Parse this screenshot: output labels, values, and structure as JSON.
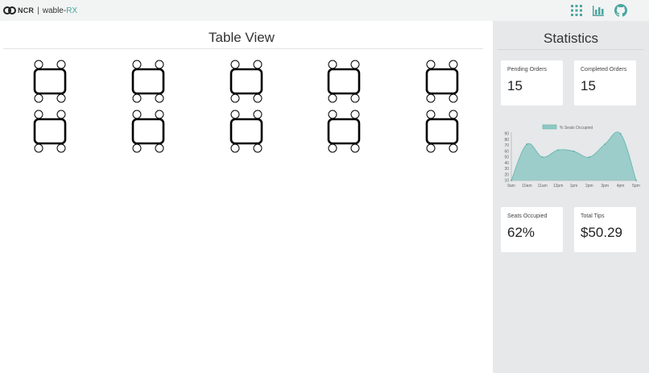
{
  "header": {
    "brand_ncr": "NCR",
    "brand_separator": "|",
    "brand_name": "wable-",
    "brand_suffix": "RX",
    "icons": [
      "grid-icon",
      "bar-chart-icon",
      "github-icon"
    ]
  },
  "main": {
    "title": "Table View",
    "tables": [
      {
        "id": "table-1"
      },
      {
        "id": "table-2"
      },
      {
        "id": "table-3"
      },
      {
        "id": "table-4"
      },
      {
        "id": "table-5"
      },
      {
        "id": "table-6"
      },
      {
        "id": "table-7"
      },
      {
        "id": "table-8"
      },
      {
        "id": "table-9"
      },
      {
        "id": "table-10"
      }
    ]
  },
  "stats": {
    "title": "Statistics",
    "pending_label": "Pending Orders",
    "pending_value": "15",
    "completed_label": "Completed Orders",
    "completed_value": "15",
    "seats_label": "Seats Occupied",
    "seats_value": "62%",
    "tips_label": "Total Tips",
    "tips_value": "$50.29"
  },
  "colors": {
    "accent": "#4aa6a0",
    "chart_fill": "#8ec8c4",
    "chart_line": "#5fb3ac",
    "sidebar_bg": "#e6e8e9"
  },
  "chart_data": {
    "type": "area",
    "legend": "% Seats Occupied",
    "legend_position": "top",
    "x": [
      "9am",
      "10am",
      "11am",
      "12pm",
      "1pm",
      "2pm",
      "3pm",
      "4pm",
      "5pm"
    ],
    "values": [
      10,
      72,
      50,
      62,
      60,
      50,
      72,
      90,
      10
    ],
    "yticks": [
      10,
      20,
      30,
      40,
      50,
      60,
      70,
      80,
      90
    ],
    "ylim": [
      10,
      90
    ],
    "grid": false
  }
}
